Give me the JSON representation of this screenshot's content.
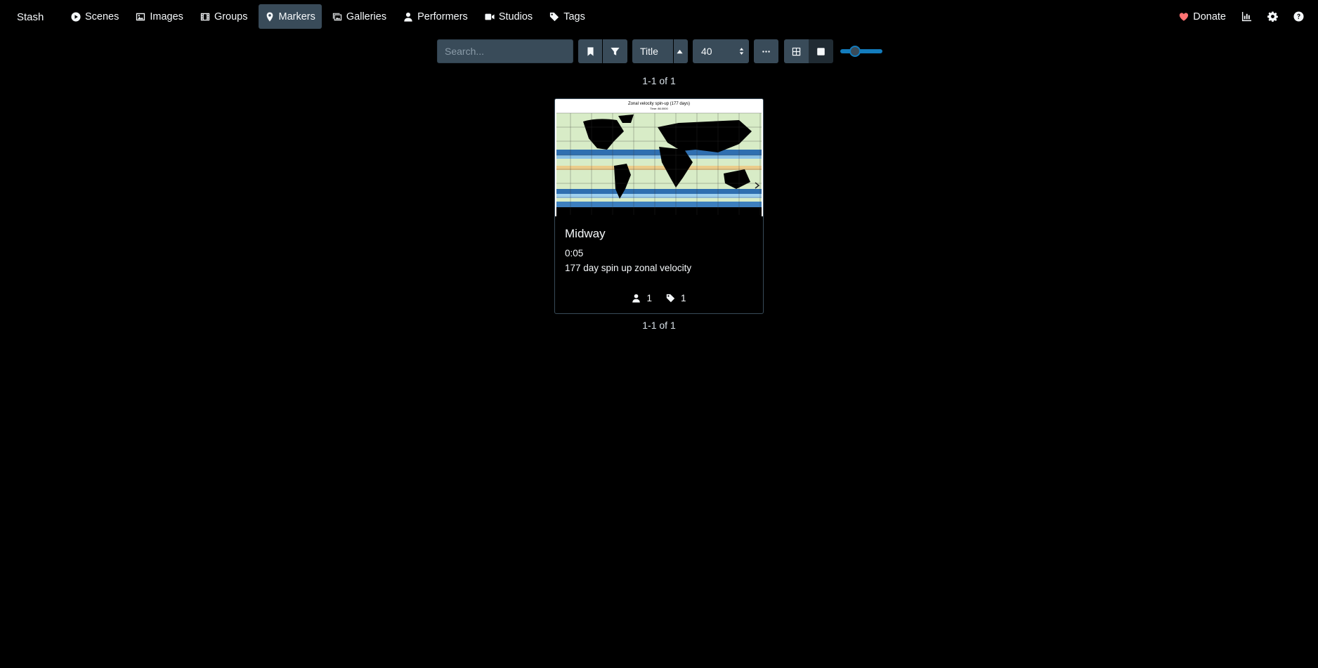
{
  "brand": "Stash",
  "nav": {
    "items": [
      {
        "label": "Scenes",
        "icon": "play-circle-icon"
      },
      {
        "label": "Images",
        "icon": "image-icon"
      },
      {
        "label": "Groups",
        "icon": "film-icon"
      },
      {
        "label": "Markers",
        "icon": "map-marker-icon",
        "active": true
      },
      {
        "label": "Galleries",
        "icon": "images-icon"
      },
      {
        "label": "Performers",
        "icon": "user-icon"
      },
      {
        "label": "Studios",
        "icon": "video-icon"
      },
      {
        "label": "Tags",
        "icon": "tag-icon"
      }
    ],
    "donate_label": "Donate"
  },
  "toolbar": {
    "search_placeholder": "Search...",
    "sort_by": "Title",
    "per_page": "40"
  },
  "pagination": {
    "top": "1-1 of 1",
    "bottom": "1-1 of 1"
  },
  "marker_card": {
    "preview_title": "Zonal velocity spin-up (177 days)",
    "preview_subtitle": "Time: 86.0000",
    "title": "Midway",
    "time": "0:05",
    "description": "177 day spin up zonal velocity",
    "performer_count": "1",
    "tag_count": "1"
  },
  "colors": {
    "accent": "#137cbd",
    "button_bg": "#394b59",
    "donate_heart": "#ff7373"
  }
}
